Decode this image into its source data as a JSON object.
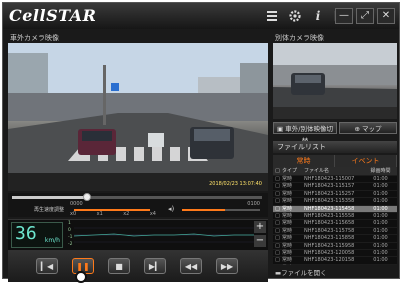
{
  "app": {
    "brand": "CellSTAR"
  },
  "titlebar": {
    "icons": [
      "list-icon",
      "gear-icon",
      "info-icon",
      "window-icon"
    ]
  },
  "window_buttons": {
    "minimize": "—",
    "maximize": "⤢",
    "close": "✕"
  },
  "main_panel": {
    "title": "車外カメラ映像"
  },
  "sub_panel": {
    "title": "別体カメラ映像",
    "switch_button": "車外/別体映像切替",
    "map_button": "マップ"
  },
  "video_overlay": {
    "timestamp": "2018/02/23 13:07:40"
  },
  "seek": {
    "start_label": "0000",
    "end_label": "0100",
    "speed_label": "再生速度調整",
    "ticks": [
      "x0",
      "x1",
      "x2",
      "x4"
    ],
    "position": 0.3,
    "volume": 0.55
  },
  "speedometer": {
    "value": "36",
    "unit": "km/h"
  },
  "graph": {
    "labels": [
      "1",
      "0",
      "-1",
      "-2"
    ],
    "plus": "+",
    "minus": "−"
  },
  "file_list": {
    "title": "ファイルリスト",
    "tabs": [
      "常時",
      "イベント"
    ],
    "columns": [
      "",
      "タイプ",
      "ファイル名",
      "録画時間"
    ],
    "rows": [
      {
        "type": "常時",
        "name": "NHF180423-115007",
        "duration": "01:00"
      },
      {
        "type": "常時",
        "name": "NHF180423-115157",
        "duration": "01:00"
      },
      {
        "type": "常時",
        "name": "NHF180423-115257",
        "duration": "01:00"
      },
      {
        "type": "常時",
        "name": "NHF180423-115358",
        "duration": "01:00"
      },
      {
        "type": "常時",
        "name": "NHF180423-115458",
        "duration": "01:00"
      },
      {
        "type": "常時",
        "name": "NHF180423-115558",
        "duration": "01:00"
      },
      {
        "type": "常時",
        "name": "NHF180423-115658",
        "duration": "01:00"
      },
      {
        "type": "常時",
        "name": "NHF180423-115758",
        "duration": "01:00"
      },
      {
        "type": "常時",
        "name": "NHF180423-115858",
        "duration": "01:00"
      },
      {
        "type": "常時",
        "name": "NHF180423-115958",
        "duration": "01:00"
      },
      {
        "type": "常時",
        "name": "NHF180423-120058",
        "duration": "01:00"
      },
      {
        "type": "常時",
        "name": "NHF180423-120158",
        "duration": "01:00"
      },
      {
        "type": "常時",
        "name": "NHF180423-120258",
        "duration": "01:00"
      },
      {
        "type": "常時",
        "name": "NHF180423-120358",
        "duration": "01:00"
      }
    ],
    "selected_row": 4,
    "open_button": "ファイルを開く"
  },
  "controls": [
    "previous-file",
    "pause",
    "stop",
    "next-frame",
    "skip-back",
    "skip-forward"
  ],
  "colors": {
    "accent": "#ff7a1a",
    "speed": "#6ee7d0"
  }
}
